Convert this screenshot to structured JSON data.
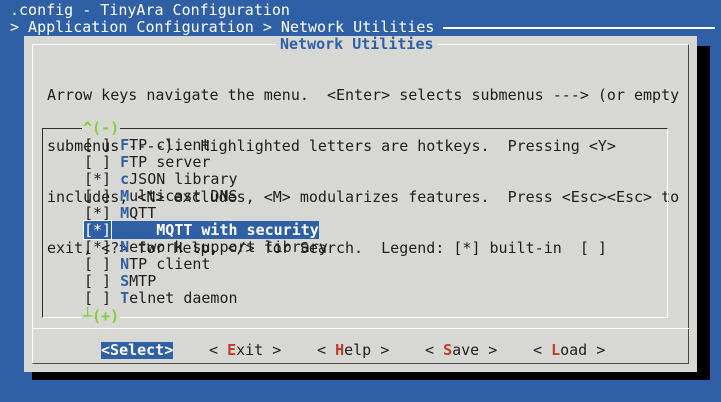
{
  "window": {
    "title": ".config - TinyAra Configuration",
    "breadcrumb": "> Application Configuration > Network Utilities"
  },
  "dialog": {
    "title": "Network Utilities",
    "help_lines": [
      "Arrow keys navigate the menu.  <Enter> selects submenus ---> (or empty",
      "submenus ----).  Highlighted letters are hotkeys.  Pressing <Y>",
      "includes, <N> excludes, <M> modularizes features.  Press <Esc><Esc> to",
      "exit, <?> for Help, </> for Search.  Legend: [*] built-in  [ ]"
    ],
    "scroll_up": "^(-)",
    "scroll_down": "(+)"
  },
  "menu": {
    "items": [
      {
        "mark": "[ ]",
        "indent": " ",
        "hotkey": "F",
        "rest": "TP client",
        "selected": false
      },
      {
        "mark": "[ ]",
        "indent": " ",
        "hotkey": "F",
        "rest": "TP server",
        "selected": false
      },
      {
        "mark": "[*]",
        "indent": " ",
        "hotkey": "c",
        "rest": "JSON library",
        "selected": false
      },
      {
        "mark": "[ ]",
        "indent": " ",
        "hotkey": "M",
        "rest": "ulticast DNS",
        "selected": false
      },
      {
        "mark": "[*]",
        "indent": " ",
        "hotkey": "M",
        "rest": "QTT",
        "selected": false
      },
      {
        "mark": "[*]",
        "indent": "     ",
        "prefix": "M",
        "hotkey": "Q",
        "rest": "TT with security",
        "selected": true
      },
      {
        "mark": "[*]",
        "indent": " ",
        "hotkey": "N",
        "rest": "etwork support library",
        "selected": false
      },
      {
        "mark": "[ ]",
        "indent": " ",
        "hotkey": "N",
        "rest": "TP client",
        "selected": false
      },
      {
        "mark": "[ ]",
        "indent": " ",
        "hotkey": "S",
        "rest": "MTP",
        "selected": false
      },
      {
        "mark": "[ ]",
        "indent": " ",
        "hotkey": "T",
        "rest": "elnet daemon",
        "selected": false
      }
    ]
  },
  "buttons": {
    "select": {
      "open": "<",
      "hotkey": "S",
      "rest": "elect",
      "close": ">"
    },
    "exit": {
      "open": "< ",
      "hotkey": "E",
      "rest": "xit",
      "close": " >"
    },
    "help": {
      "open": "< ",
      "hotkey": "H",
      "rest": "elp",
      "close": " >"
    },
    "save": {
      "open": "< ",
      "hotkey": "S",
      "rest": "ave",
      "close": " >"
    },
    "load": {
      "open": "< ",
      "hotkey": "L",
      "rest": "oad",
      "close": " >"
    }
  },
  "colors": {
    "background": "#2f5fa5",
    "dialog": "#d7d7d3",
    "hotkey_menu": "#2f5fa5",
    "hotkey_button": "#c0392b",
    "scroll_indicator": "#7bd13a"
  }
}
